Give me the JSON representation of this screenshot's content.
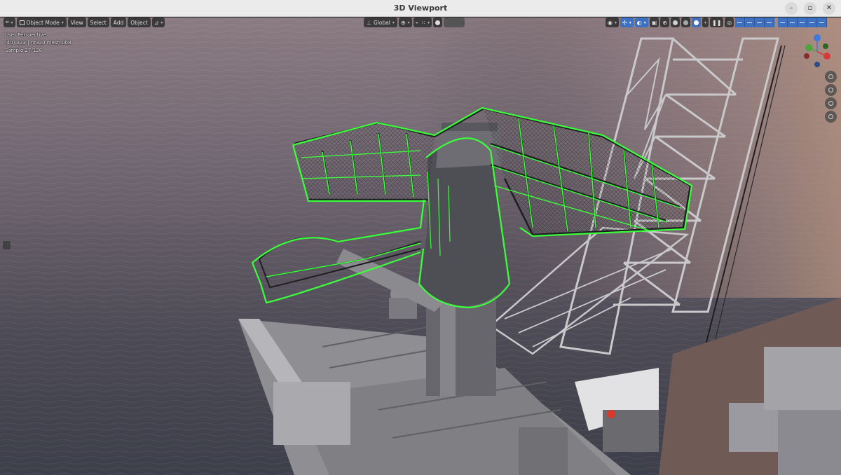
{
  "window": {
    "title": "3D Viewport",
    "controls": {
      "minimize": "–",
      "maximize": "▫",
      "close": "✕"
    }
  },
  "toolbar": {
    "editor_type_icon": "viewport-editor-icon",
    "mode": "Object Mode",
    "menus": [
      "View",
      "Select",
      "Add",
      "Object"
    ],
    "transform_orientation": "Global",
    "shading_mode": "rendered"
  },
  "overlay": {
    "line1": "User Perspective",
    "line2": "(40) 323 | nr320 mesh.008",
    "line3": "Sample 27/128"
  },
  "gizmo": {
    "axes": [
      "X",
      "Y",
      "Z"
    ],
    "colors": {
      "x": "#d63c3c",
      "y": "#4aa53a",
      "z": "#3f79d9"
    }
  },
  "selection_color": "#3bff3b",
  "scene": {
    "description_icons": [
      "radar-antenna",
      "crane-lattice",
      "ship-deck",
      "ocean-sunset"
    ]
  }
}
